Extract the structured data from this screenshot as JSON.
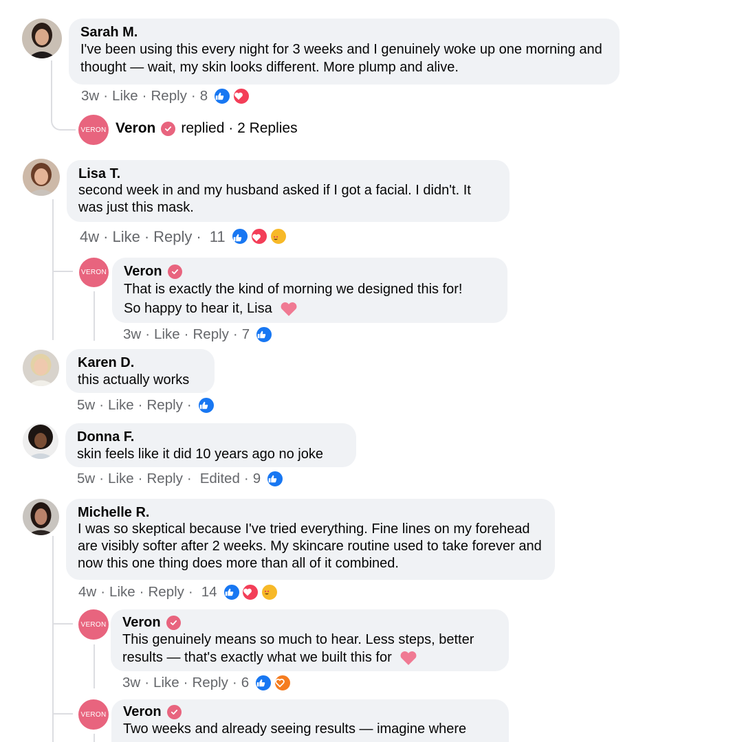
{
  "icons": {
    "like": "thumbs-up-icon",
    "love": "heart-icon",
    "wow": "heart-eyes-icon",
    "verified": "check-badge-icon",
    "inline_heart": "pink-heart-emoji"
  },
  "colors": {
    "brand": "#e8647e",
    "like": "#1877f2",
    "love": "#f33e58",
    "bubble": "#f0f2f5",
    "meta": "#65676b"
  },
  "brand_avatar_text": "VERON",
  "comments": [
    {
      "name": "Sarah M.",
      "text": "I've been using this every night for 3 weeks and I genuinely woke up one morning and thought — wait, my skin looks different. More plump and alive.",
      "time": "3w",
      "like": "Like",
      "reply": "Reply",
      "count": "8",
      "replied_summary": {
        "name": "Veron",
        "text": "replied · 2 Replies"
      }
    },
    {
      "name": "Lisa T.",
      "text": "second week in and my husband asked if I got a facial. I didn't. It was just this mask.",
      "time": "4w",
      "like": "Like",
      "reply": "Reply",
      "count": "11",
      "reply_item": {
        "name": "Veron",
        "text_line1": "That is exactly the kind of morning we designed this for!",
        "text_line2": "So happy to hear it, Lisa",
        "time": "3w",
        "like": "Like",
        "reply": "Reply",
        "count": "7"
      }
    },
    {
      "name": "Karen D.",
      "text": "this actually works",
      "time": "5w",
      "like": "Like",
      "reply": "Reply"
    },
    {
      "name": "Donna F.",
      "text": "skin feels like it did 10 years ago no joke",
      "time": "5w",
      "like": "Like",
      "reply": "Reply",
      "edited": "Edited",
      "count": "9"
    },
    {
      "name": "Michelle R.",
      "text": "I was so skeptical because I've tried everything. Fine lines on my forehead are visibly softer after 2 weeks. My skincare routine used to take forever and now this one thing does more than all of it combined.",
      "time": "4w",
      "like": "Like",
      "reply": "Reply",
      "count": "14",
      "replies": [
        {
          "name": "Veron",
          "text": "This genuinely means so much to hear. Less steps, better results — that's exactly what we built this for",
          "time": "3w",
          "like": "Like",
          "reply": "Reply",
          "count": "6"
        },
        {
          "name": "Veron",
          "text": "Two weeks and already seeing results — imagine where"
        }
      ]
    }
  ]
}
